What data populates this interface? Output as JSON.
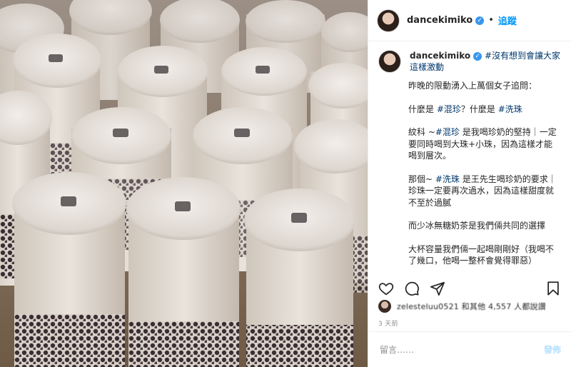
{
  "post": {
    "username": "dancekimiko",
    "verified_mark": "✓",
    "follow_label": "追蹤",
    "separator": "•",
    "caption_title_tag": "#沒有想到會讓大家這樣激動",
    "caption": {
      "p1": "昨晚的限動湧入上萬個女子追問：",
      "p2_prefix": "什麼是 ",
      "p2_tag1": "#混珍",
      "p2_mid": "？什麼是 ",
      "p2_tag2": "#洗珠",
      "p3_prefix": "紋科 ~",
      "p3_tag": "#混珍",
      "p3_rest": " 是我喝珍奶的堅持｜一定要同時喝到大珠+小珠，因為這樣才能喝到層次。",
      "p4_prefix": "那個~ ",
      "p4_tag": "#洗珠",
      "p4_rest": " 是王先生喝珍奶的要求｜珍珠一定要再次過水，因為這樣甜度就不至於過膩",
      "p5": "而少冰無糖奶茶是我們倆共同的選擇",
      "p6": "大杯容量我們倆一起喝剛剛好（我喝不了幾口，他喝一整杯會覺得罪惡）"
    },
    "likes_text": "zelesteluu0521 和其他 4,557 人都說讚",
    "time_ago": "3 天前",
    "comment_placeholder": "留言……",
    "post_button_label": "發佈"
  },
  "icons": {
    "heart": "heart-icon",
    "comment": "comment-icon",
    "share": "share-icon",
    "save": "bookmark-icon"
  },
  "colors": {
    "link": "#0095f6",
    "tag": "#00376b",
    "verified": "#3897f0",
    "post_disabled": "#b2dffc"
  }
}
